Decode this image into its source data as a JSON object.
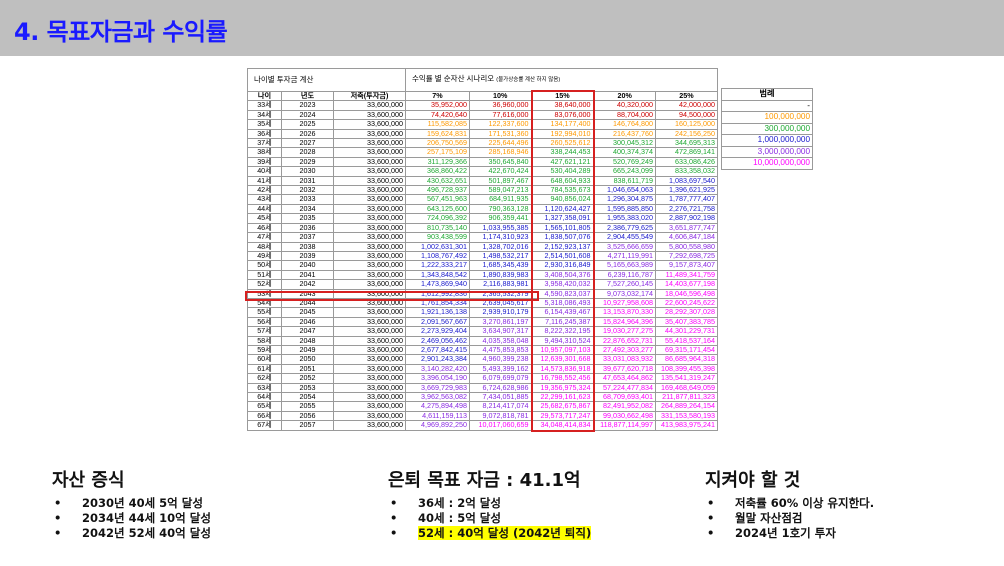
{
  "slide_title": "4. 목표자금과 수익률",
  "table": {
    "section_left": "나이별 투자금 계산",
    "section_right": "수익률 별 순자산 시나리오",
    "section_right_note": "(물가상승률 계산 하지 않음)",
    "headers": [
      "나이",
      "년도",
      "저축(투자금)",
      "7%",
      "10%",
      "15%",
      "20%",
      "25%"
    ],
    "rows": [
      [
        "33세",
        "2023",
        "33,600,000",
        "35,952,000",
        "36,960,000",
        "38,640,000",
        "40,320,000",
        "42,000,000"
      ],
      [
        "34세",
        "2024",
        "33,600,000",
        "74,420,640",
        "77,616,000",
        "83,076,000",
        "88,704,000",
        "94,500,000"
      ],
      [
        "35세",
        "2025",
        "33,600,000",
        "115,582,085",
        "122,337,600",
        "134,177,400",
        "146,764,800",
        "160,125,000"
      ],
      [
        "36세",
        "2026",
        "33,600,000",
        "159,624,831",
        "171,531,360",
        "192,994,010",
        "216,437,760",
        "242,156,250"
      ],
      [
        "37세",
        "2027",
        "33,600,000",
        "206,750,569",
        "225,644,496",
        "260,525,612",
        "300,045,312",
        "344,695,313"
      ],
      [
        "38세",
        "2028",
        "33,600,000",
        "257,175,109",
        "285,168,946",
        "338,244,453",
        "400,374,374",
        "472,869,141"
      ],
      [
        "39세",
        "2029",
        "33,600,000",
        "311,129,366",
        "350,645,840",
        "427,621,121",
        "520,769,249",
        "633,086,426"
      ],
      [
        "40세",
        "2030",
        "33,600,000",
        "368,860,422",
        "422,670,424",
        "530,404,289",
        "665,243,099",
        "833,358,032"
      ],
      [
        "41세",
        "2031",
        "33,600,000",
        "430,632,651",
        "501,897,467",
        "648,604,933",
        "838,611,719",
        "1,083,697,540"
      ],
      [
        "42세",
        "2032",
        "33,600,000",
        "496,728,937",
        "589,047,213",
        "784,535,673",
        "1,046,654,063",
        "1,396,621,925"
      ],
      [
        "43세",
        "2033",
        "33,600,000",
        "567,451,963",
        "684,911,935",
        "940,856,024",
        "1,296,304,875",
        "1,787,777,407"
      ],
      [
        "44세",
        "2034",
        "33,600,000",
        "643,125,600",
        "790,363,128",
        "1,120,624,427",
        "1,595,885,850",
        "2,276,721,758"
      ],
      [
        "45세",
        "2035",
        "33,600,000",
        "724,096,392",
        "906,359,441",
        "1,327,358,091",
        "1,955,383,020",
        "2,887,902,198"
      ],
      [
        "46세",
        "2036",
        "33,600,000",
        "810,735,140",
        "1,033,955,385",
        "1,565,101,805",
        "2,386,779,625",
        "3,651,877,747"
      ],
      [
        "47세",
        "2037",
        "33,600,000",
        "903,438,599",
        "1,174,310,923",
        "1,838,507,076",
        "2,904,455,549",
        "4,606,847,184"
      ],
      [
        "48세",
        "2038",
        "33,600,000",
        "1,002,631,301",
        "1,328,702,016",
        "2,152,923,137",
        "3,525,666,659",
        "5,800,558,980"
      ],
      [
        "49세",
        "2039",
        "33,600,000",
        "1,108,767,492",
        "1,498,532,217",
        "2,514,501,608",
        "4,271,119,991",
        "7,292,698,725"
      ],
      [
        "50세",
        "2040",
        "33,600,000",
        "1,222,333,217",
        "1,685,345,439",
        "2,930,316,849",
        "5,165,663,989",
        "9,157,873,407"
      ],
      [
        "51세",
        "2041",
        "33,600,000",
        "1,343,848,542",
        "1,890,839,983",
        "3,408,504,376",
        "6,239,116,787",
        "11,489,341,759"
      ],
      [
        "52세",
        "2042",
        "33,600,000",
        "1,473,869,940",
        "2,116,883,981",
        "3,958,420,032",
        "7,527,260,145",
        "14,403,677,198"
      ],
      [
        "53세",
        "2043",
        "33,600,000",
        "1,612,992,836",
        "2,365,532,379",
        "4,590,823,037",
        "9,073,032,174",
        "18,046,596,498"
      ],
      [
        "54세",
        "2044",
        "33,600,000",
        "1,761,854,334",
        "2,639,045,617",
        "5,318,086,493",
        "10,927,958,608",
        "22,600,245,622"
      ],
      [
        "55세",
        "2045",
        "33,600,000",
        "1,921,136,138",
        "2,939,910,179",
        "6,154,439,467",
        "13,153,870,330",
        "28,292,307,028"
      ],
      [
        "56세",
        "2046",
        "33,600,000",
        "2,091,567,667",
        "3,270,861,197",
        "7,116,245,387",
        "15,824,964,396",
        "35,407,383,785"
      ],
      [
        "57세",
        "2047",
        "33,600,000",
        "2,273,929,404",
        "3,634,907,317",
        "8,222,322,195",
        "19,030,277,275",
        "44,301,229,731"
      ],
      [
        "58세",
        "2048",
        "33,600,000",
        "2,469,056,462",
        "4,035,358,048",
        "9,494,310,524",
        "22,876,652,731",
        "55,418,537,164"
      ],
      [
        "59세",
        "2049",
        "33,600,000",
        "2,677,842,415",
        "4,475,853,853",
        "10,957,097,103",
        "27,492,303,277",
        "69,315,171,454"
      ],
      [
        "60세",
        "2050",
        "33,600,000",
        "2,901,243,384",
        "4,960,399,238",
        "12,639,301,668",
        "33,031,083,932",
        "86,685,964,318"
      ],
      [
        "61세",
        "2051",
        "33,600,000",
        "3,140,282,420",
        "5,493,399,162",
        "14,573,836,918",
        "39,677,620,718",
        "108,399,455,398"
      ],
      [
        "62세",
        "2052",
        "33,600,000",
        "3,396,054,190",
        "6,079,699,079",
        "16,798,552,456",
        "47,653,464,862",
        "135,541,319,247"
      ],
      [
        "63세",
        "2053",
        "33,600,000",
        "3,669,729,983",
        "6,724,628,986",
        "19,356,975,324",
        "57,224,477,834",
        "169,468,649,059"
      ],
      [
        "64세",
        "2054",
        "33,600,000",
        "3,962,563,082",
        "7,434,051,885",
        "22,299,161,623",
        "68,709,693,401",
        "211,877,811,323"
      ],
      [
        "65세",
        "2055",
        "33,600,000",
        "4,275,894,498",
        "8,214,417,074",
        "25,682,675,867",
        "82,491,952,082",
        "264,889,264,154"
      ],
      [
        "66세",
        "2056",
        "33,600,000",
        "4,611,159,113",
        "9,072,818,781",
        "29,573,717,247",
        "99,030,662,498",
        "331,153,580,193"
      ],
      [
        "67세",
        "2057",
        "33,600,000",
        "4,969,892,250",
        "10,017,060,659",
        "34,048,414,834",
        "118,877,114,997",
        "413,983,975,241"
      ]
    ]
  },
  "legend": {
    "title": "범례",
    "items": [
      {
        "label": "-",
        "color": "#000000"
      },
      {
        "label": "100,000,000",
        "color": "#ff9900"
      },
      {
        "label": "300,000,000",
        "color": "#1ea832"
      },
      {
        "label": "1,000,000,000",
        "color": "#1a1acc"
      },
      {
        "label": "3,000,000,000",
        "color": "#8a2be2"
      },
      {
        "label": "10,000,000,000",
        "color": "#ff00ff"
      }
    ],
    "base_color": "#cc0000"
  },
  "asset_growth": {
    "title": "자산 증식",
    "items": [
      "2030년 40세 5억 달성",
      "2034년 44세 10억 달성",
      "2042년 52세 40억 달성"
    ]
  },
  "retirement": {
    "title": "은퇴 목표 자금 : 41.1억",
    "items": [
      "36세 : 2억 달성",
      "40세 : 5억 달성",
      "52세 : 40억 달성 (2042년 퇴직)"
    ]
  },
  "todo": {
    "title": "지켜야 할 것",
    "items": [
      "저축률 60% 이상 유지한다.",
      "월말 자산점검",
      "2024년 1호기 투자"
    ]
  }
}
